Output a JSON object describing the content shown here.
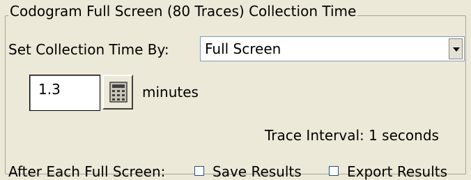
{
  "groupbox": {
    "title": "Codogram Full Screen (80 Traces) Collection Time"
  },
  "collection_time": {
    "label": "Set Collection Time By:",
    "selected": "Full Screen"
  },
  "duration": {
    "value": "1.3",
    "unit": "minutes",
    "calculator_icon": "calculator-icon"
  },
  "trace_interval": {
    "text": "Trace Interval: 1 seconds"
  },
  "after_full_screen": {
    "label": "After Each Full Screen:",
    "save_results": {
      "label": "Save Results",
      "checked": false
    },
    "export_results": {
      "label": "Export Results",
      "checked": false
    }
  },
  "colors": {
    "background": "#ece9d8",
    "group_border": "#a8a496",
    "field_border": "#7f9db9"
  }
}
